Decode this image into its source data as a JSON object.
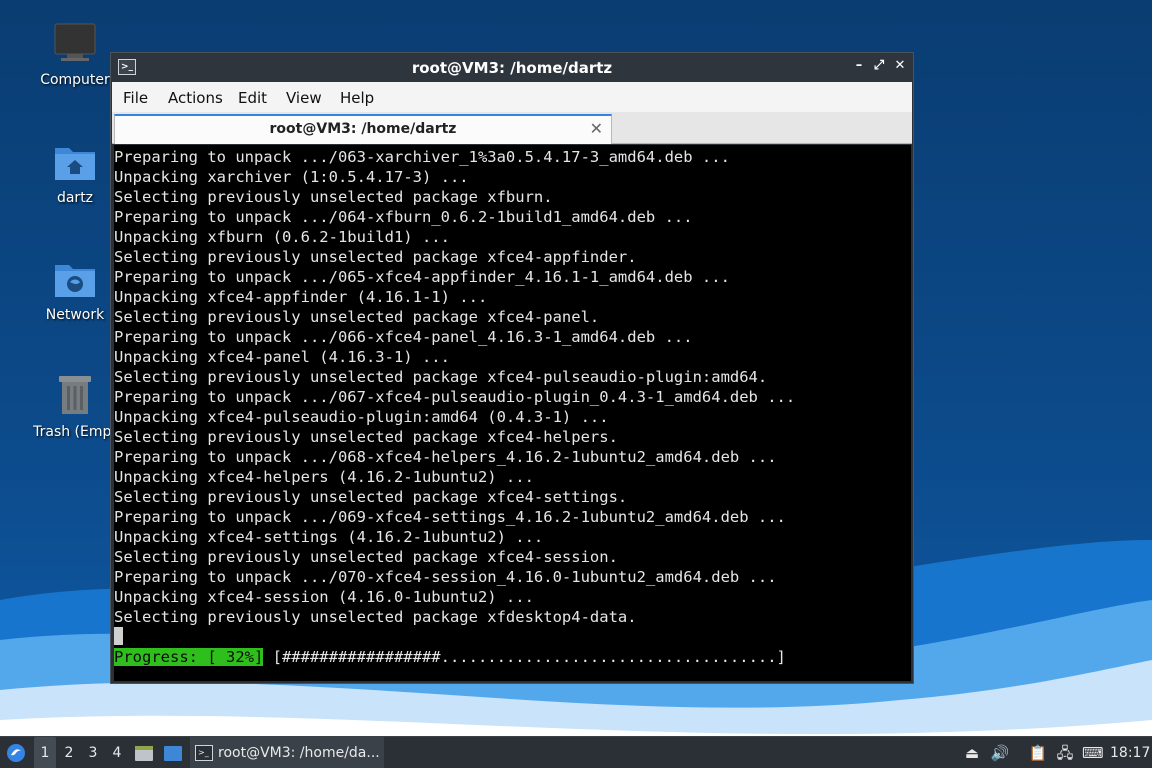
{
  "desktop": {
    "icons": [
      {
        "label": "Computer",
        "icon": "monitor-icon"
      },
      {
        "label": "dartz",
        "icon": "home-folder-icon"
      },
      {
        "label": "Network",
        "icon": "network-folder-icon"
      },
      {
        "label": "Trash (Empt",
        "icon": "trash-icon"
      }
    ]
  },
  "window": {
    "title": "root@VM3: /home/dartz",
    "controls": {
      "minimize": "–",
      "maximize": "⤢",
      "close": "✕"
    },
    "menu": [
      "File",
      "Actions",
      "Edit",
      "View",
      "Help"
    ],
    "tab": {
      "title": "root@VM3: /home/dartz",
      "close": "✕"
    }
  },
  "terminal": {
    "lines": [
      "Preparing to unpack .../063-xarchiver_1%3a0.5.4.17-3_amd64.deb ...",
      "Unpacking xarchiver (1:0.5.4.17-3) ...",
      "Selecting previously unselected package xfburn.",
      "Preparing to unpack .../064-xfburn_0.6.2-1build1_amd64.deb ...",
      "Unpacking xfburn (0.6.2-1build1) ...",
      "Selecting previously unselected package xfce4-appfinder.",
      "Preparing to unpack .../065-xfce4-appfinder_4.16.1-1_amd64.deb ...",
      "Unpacking xfce4-appfinder (4.16.1-1) ...",
      "Selecting previously unselected package xfce4-panel.",
      "Preparing to unpack .../066-xfce4-panel_4.16.3-1_amd64.deb ...",
      "Unpacking xfce4-panel (4.16.3-1) ...",
      "Selecting previously unselected package xfce4-pulseaudio-plugin:amd64.",
      "Preparing to unpack .../067-xfce4-pulseaudio-plugin_0.4.3-1_amd64.deb ...",
      "Unpacking xfce4-pulseaudio-plugin:amd64 (0.4.3-1) ...",
      "Selecting previously unselected package xfce4-helpers.",
      "Preparing to unpack .../068-xfce4-helpers_4.16.2-1ubuntu2_amd64.deb ...",
      "Unpacking xfce4-helpers (4.16.2-1ubuntu2) ...",
      "Selecting previously unselected package xfce4-settings.",
      "Preparing to unpack .../069-xfce4-settings_4.16.2-1ubuntu2_amd64.deb ...",
      "Unpacking xfce4-settings (4.16.2-1ubuntu2) ...",
      "Selecting previously unselected package xfce4-session.",
      "Preparing to unpack .../070-xfce4-session_4.16.0-1ubuntu2_amd64.deb ...",
      "Unpacking xfce4-session (4.16.0-1ubuntu2) ...",
      "Selecting previously unselected package xfdesktop4-data."
    ],
    "progress": {
      "label": "Progress: [ 32%]",
      "bar": " [#################....................................]",
      "percent": 32
    }
  },
  "taskbar": {
    "workspaces": [
      "1",
      "2",
      "3",
      "4"
    ],
    "active_workspace": "1",
    "task_title": "root@VM3: /home/da...",
    "clock": "18:17",
    "tray_icons": [
      "eject-icon",
      "volume-icon",
      "clipboard-icon",
      "network-icon",
      "keyboard-icon"
    ]
  },
  "colors": {
    "progress_green": "#2fbf1c",
    "desktop_blue": "#0c4a8a",
    "accent": "#3584e4"
  }
}
